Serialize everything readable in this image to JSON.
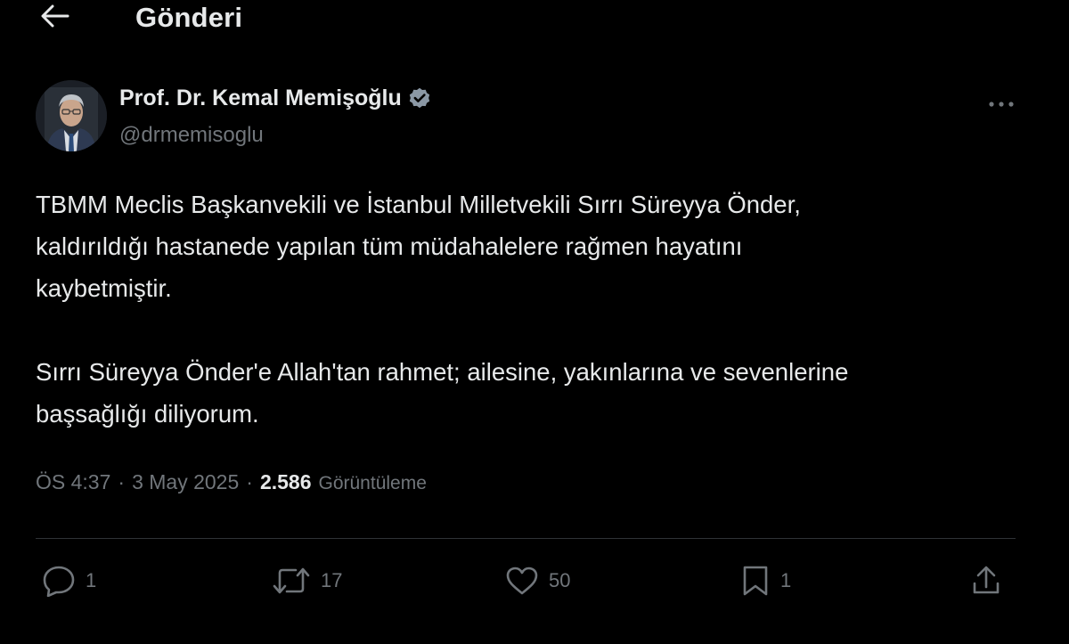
{
  "header": {
    "title": "Gönderi",
    "back_icon": "arrow-left-icon"
  },
  "post": {
    "author": {
      "name": "Prof. Dr. Kemal Memişoğlu",
      "handle": "@drmemisoglu",
      "verified": true,
      "verified_icon": "verified-badge-icon"
    },
    "text": "TBMM Meclis Başkanvekili ve İstanbul Milletvekili Sırrı Süreyya Önder,\nkaldırıldığı hastanede yapılan tüm müdahalelere rağmen hayatını\nkaybetmiştir.\n\nSırrı Süreyya Önder'e Allah'tan rahmet; ailesine, yakınlarına ve sevenlerine\nbaşsağlığı diliyorum.",
    "meta": {
      "time": "ÖS 4:37",
      "date": "3 May 2025",
      "separator": "·",
      "views": "2.586",
      "views_label": "Görüntüleme"
    },
    "actions": {
      "replies": "1",
      "reposts": "17",
      "likes": "50",
      "bookmarks": "1"
    }
  },
  "colors": {
    "background": "#000000",
    "text": "#e7e9ea",
    "secondary": "#71767b",
    "divider": "#2f3336",
    "verified_badge": "#8b98a5"
  }
}
